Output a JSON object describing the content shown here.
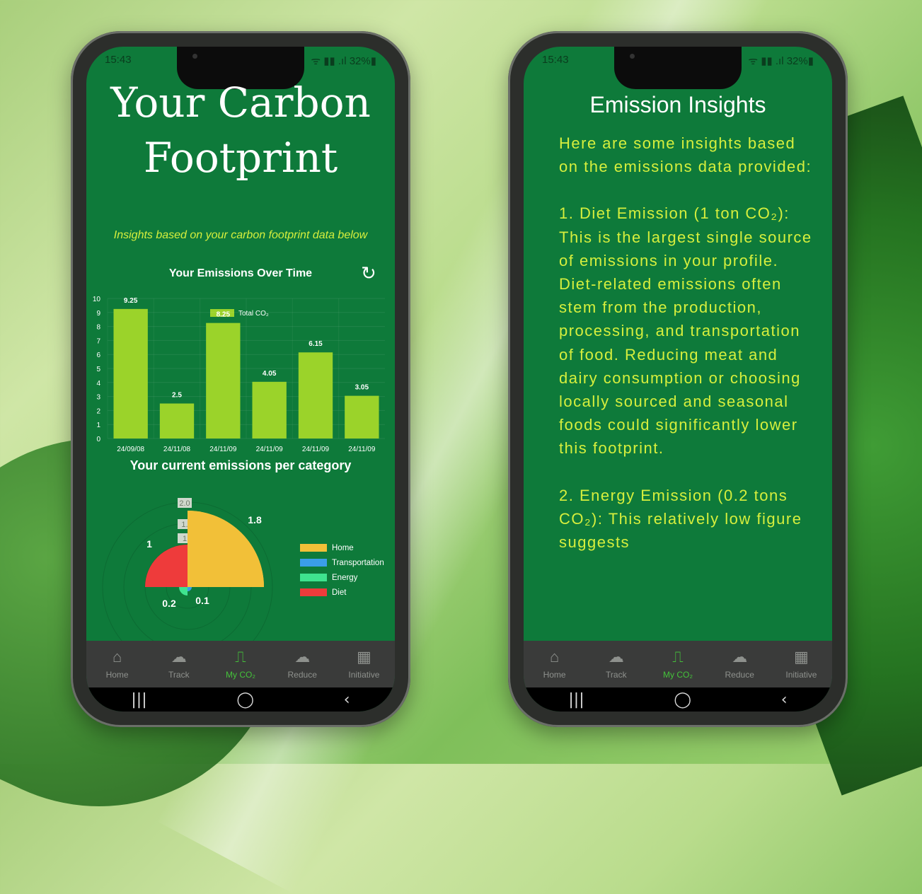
{
  "status": {
    "time": "15:43",
    "right": "ᯤ ▮▮ .ıl 32%▮"
  },
  "nav": [
    {
      "label": "Home",
      "icon": "home-icon",
      "glyph": "⌂"
    },
    {
      "label": "Track",
      "icon": "cloud-co2-icon",
      "glyph": "☁"
    },
    {
      "label": "My CO₂",
      "icon": "chart-co2-icon",
      "glyph": "⎍"
    },
    {
      "label": "Reduce",
      "icon": "cloud-reduce-icon",
      "glyph": "☁"
    },
    {
      "label": "Initiative",
      "icon": "calendar-icon",
      "glyph": "▦"
    }
  ],
  "sysbar": [
    "|||",
    "◯",
    "‹"
  ],
  "left": {
    "title_line1": "Your Carbon",
    "title_line2": "Footprint",
    "subtitle": "Insights based on your carbon footprint data below",
    "chart_title": "Your Emissions Over Time",
    "category_title": "Your current emissions per category"
  },
  "right": {
    "title": "Emission Insights",
    "paragraphs": [
      "Here are some insights based on the emissions data provided:",
      "1. Diet Emission (1 ton CO₂): This is the largest single source of emissions in your profile. Diet-related emissions often stem from the production, processing, and transportation of food. Reducing meat and dairy consumption or choosing locally sourced and seasonal foods could significantly lower this footprint.",
      "2. Energy Emission (0.2 tons CO₂): This relatively low figure suggests"
    ]
  },
  "colors": {
    "screen": "#0e7a3a",
    "bar": "#9bd32a",
    "accent_text": "#d6ef3d",
    "nav_active": "#44c23a"
  },
  "chart_data": [
    {
      "type": "bar",
      "title": "Your Emissions Over Time",
      "legend": "Total CO₂",
      "categories": [
        "24/09/08",
        "24/11/08",
        "24/11/09",
        "24/11/09",
        "24/11/09",
        "24/11/09"
      ],
      "values": [
        9.25,
        2.5,
        8.25,
        4.05,
        6.15,
        3.05
      ],
      "value_labels": [
        "9.25",
        "2.5",
        "8.25",
        "4.05",
        "6.15",
        "3.05"
      ],
      "ylim": [
        0,
        10
      ],
      "yticks": [
        "0",
        "1",
        "2",
        "3",
        "4",
        "5",
        "6",
        "7",
        "8",
        "9",
        "10"
      ]
    },
    {
      "type": "pie",
      "title": "Your current emissions per category",
      "categories": [
        "Home",
        "Transportation",
        "Energy",
        "Diet"
      ],
      "values": [
        1.8,
        0.1,
        0.2,
        1
      ],
      "value_labels": [
        "1.8",
        "0.1",
        "0.2",
        "1"
      ],
      "colors": [
        "#f2c038",
        "#3a9ee8",
        "#3fe38f",
        "#ee3b3b"
      ],
      "rlim": [
        0,
        2.0
      ],
      "rticks_visible": [
        "2.0",
        "1.",
        "1"
      ]
    }
  ]
}
